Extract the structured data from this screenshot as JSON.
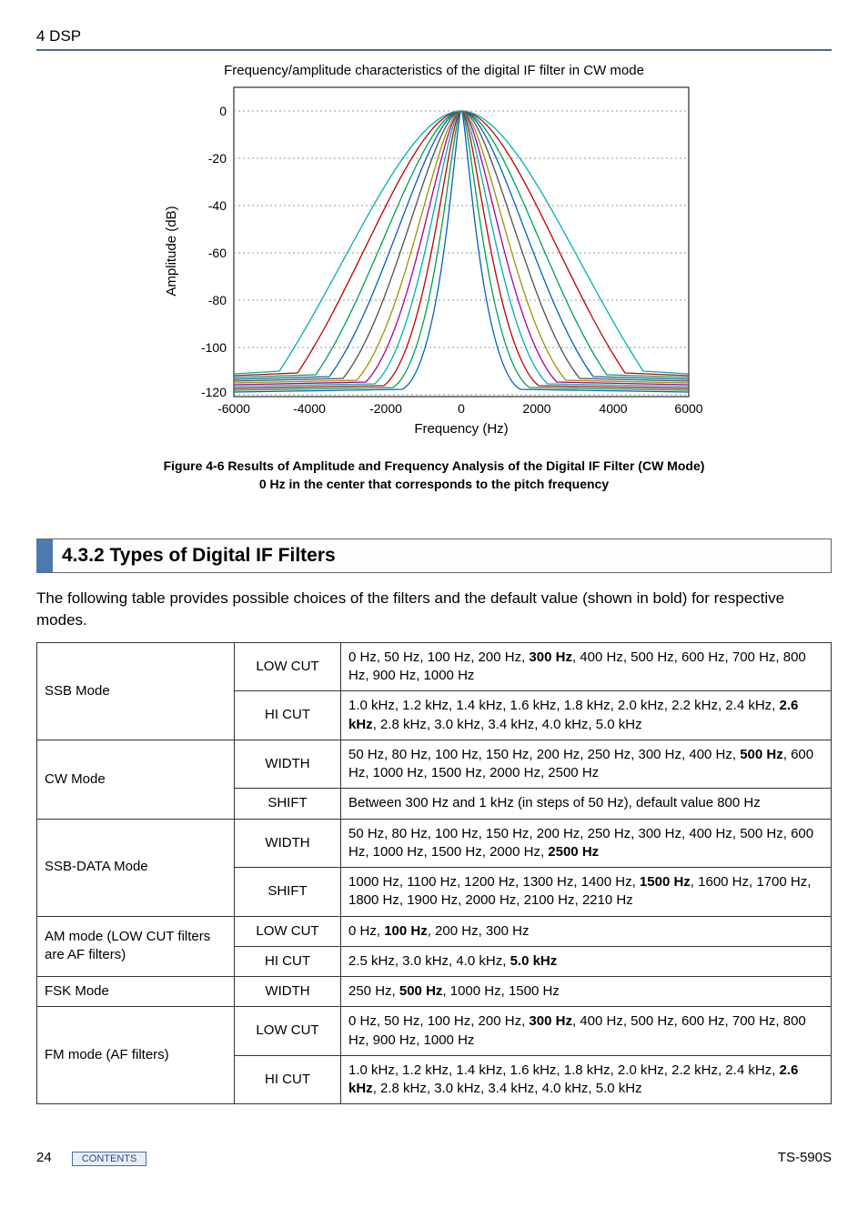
{
  "header": "4 DSP",
  "chart_data": {
    "type": "line",
    "title": "Frequency/amplitude characteristics of the digital IF filter in CW mode",
    "xlabel": "Frequency (Hz)",
    "ylabel": "Amplitude (dB)",
    "xlim": [
      -6000,
      6000
    ],
    "ylim": [
      -130,
      10
    ],
    "xticks": [
      -6000,
      -4000,
      -2000,
      0,
      2000,
      4000,
      6000
    ],
    "yticks": [
      0,
      -20,
      -40,
      -60,
      -80,
      -100,
      -120
    ],
    "note": "Multiple bandpass curves of varying width centered on 0 Hz, passband ~0 dB, skirts falling to ~-120 dB"
  },
  "caption_line1": "Figure 4-6   Results of Amplitude and Frequency Analysis of the Digital IF Filter (CW Mode)",
  "caption_line2": "0 Hz in the center that corresponds to the pitch frequency",
  "section_title": "4.3.2  Types of Digital IF Filters",
  "intro": "The following table provides possible choices of the filters and the default value (shown in bold) for respective modes.",
  "table": [
    {
      "mode": "SSB Mode",
      "rows": [
        {
          "param": "LOW CUT",
          "val_pre": "0 Hz, 50 Hz, 100 Hz, 200 Hz, ",
          "val_bold": "300 Hz",
          "val_post": ", 400 Hz, 500 Hz, 600 Hz, 700 Hz, 800 Hz, 900 Hz, 1000 Hz"
        },
        {
          "param": "HI CUT",
          "val_pre": "1.0 kHz, 1.2 kHz, 1.4 kHz, 1.6 kHz, 1.8 kHz, 2.0 kHz, 2.2 kHz, 2.4 kHz, ",
          "val_bold": "2.6 kHz",
          "val_post": ", 2.8 kHz, 3.0 kHz, 3.4 kHz, 4.0 kHz, 5.0 kHz"
        }
      ]
    },
    {
      "mode": "CW Mode",
      "rows": [
        {
          "param": "WIDTH",
          "val_pre": "50 Hz, 80 Hz, 100 Hz, 150 Hz, 200 Hz, 250 Hz, 300 Hz, 400 Hz, ",
          "val_bold": "500 Hz",
          "val_post": ", 600 Hz, 1000 Hz, 1500 Hz, 2000 Hz, 2500 Hz"
        },
        {
          "param": "SHIFT",
          "val_pre": "Between 300 Hz and 1 kHz (in steps of 50 Hz), default value 800 Hz",
          "val_bold": "",
          "val_post": ""
        }
      ]
    },
    {
      "mode": "SSB-DATA Mode",
      "rows": [
        {
          "param": "WIDTH",
          "val_pre": "50 Hz, 80 Hz, 100 Hz, 150 Hz, 200 Hz, 250 Hz, 300 Hz, 400 Hz, 500 Hz, 600 Hz, 1000 Hz, 1500 Hz, 2000 Hz, ",
          "val_bold": "2500 Hz",
          "val_post": ""
        },
        {
          "param": "SHIFT",
          "val_pre": "1000 Hz, 1100 Hz, 1200 Hz, 1300 Hz, 1400 Hz, ",
          "val_bold": "1500 Hz",
          "val_post": ", 1600 Hz, 1700 Hz, 1800 Hz, 1900 Hz, 2000 Hz, 2100 Hz, 2210 Hz"
        }
      ]
    },
    {
      "mode": "AM mode (LOW CUT filters are AF filters)",
      "rows": [
        {
          "param": "LOW CUT",
          "val_pre": "0 Hz, ",
          "val_bold": "100 Hz",
          "val_post": ", 200 Hz, 300 Hz"
        },
        {
          "param": "HI CUT",
          "val_pre": "2.5 kHz, 3.0 kHz, 4.0 kHz, ",
          "val_bold": "5.0 kHz",
          "val_post": ""
        }
      ]
    },
    {
      "mode": "FSK Mode",
      "rows": [
        {
          "param": "WIDTH",
          "val_pre": "250 Hz, ",
          "val_bold": "500 Hz",
          "val_post": ", 1000 Hz, 1500 Hz"
        }
      ]
    },
    {
      "mode": "FM mode (AF filters)",
      "rows": [
        {
          "param": "LOW CUT",
          "val_pre": "0 Hz, 50 Hz, 100 Hz, 200 Hz, ",
          "val_bold": "300 Hz",
          "val_post": ", 400 Hz, 500 Hz, 600 Hz, 700 Hz, 800 Hz, 900 Hz, 1000 Hz"
        },
        {
          "param": "HI CUT",
          "val_pre": "1.0 kHz, 1.2 kHz, 1.4 kHz, 1.6 kHz, 1.8 kHz, 2.0 kHz, 2.2 kHz, 2.4 kHz, ",
          "val_bold": "2.6 kHz",
          "val_post": ", 2.8 kHz, 3.0 kHz, 3.4 kHz, 4.0 kHz, 5.0 kHz"
        }
      ]
    }
  ],
  "footer": {
    "page": "24",
    "contents": "CONTENTS",
    "model": "TS-590S"
  }
}
